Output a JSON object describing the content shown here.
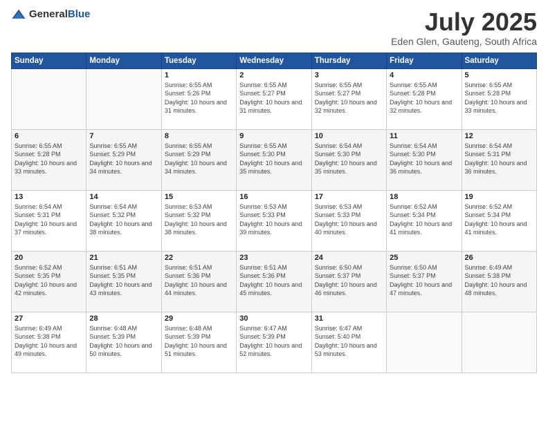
{
  "header": {
    "logo": {
      "general": "General",
      "blue": "Blue"
    },
    "title": "July 2025",
    "subtitle": "Eden Glen, Gauteng, South Africa"
  },
  "calendar": {
    "weekdays": [
      "Sunday",
      "Monday",
      "Tuesday",
      "Wednesday",
      "Thursday",
      "Friday",
      "Saturday"
    ],
    "weeks": [
      [
        {
          "day": "",
          "sunrise": "",
          "sunset": "",
          "daylight": ""
        },
        {
          "day": "",
          "sunrise": "",
          "sunset": "",
          "daylight": ""
        },
        {
          "day": "1",
          "sunrise": "Sunrise: 6:55 AM",
          "sunset": "Sunset: 5:26 PM",
          "daylight": "Daylight: 10 hours and 31 minutes."
        },
        {
          "day": "2",
          "sunrise": "Sunrise: 6:55 AM",
          "sunset": "Sunset: 5:27 PM",
          "daylight": "Daylight: 10 hours and 31 minutes."
        },
        {
          "day": "3",
          "sunrise": "Sunrise: 6:55 AM",
          "sunset": "Sunset: 5:27 PM",
          "daylight": "Daylight: 10 hours and 32 minutes."
        },
        {
          "day": "4",
          "sunrise": "Sunrise: 6:55 AM",
          "sunset": "Sunset: 5:28 PM",
          "daylight": "Daylight: 10 hours and 32 minutes."
        },
        {
          "day": "5",
          "sunrise": "Sunrise: 6:55 AM",
          "sunset": "Sunset: 5:28 PM",
          "daylight": "Daylight: 10 hours and 33 minutes."
        }
      ],
      [
        {
          "day": "6",
          "sunrise": "Sunrise: 6:55 AM",
          "sunset": "Sunset: 5:28 PM",
          "daylight": "Daylight: 10 hours and 33 minutes."
        },
        {
          "day": "7",
          "sunrise": "Sunrise: 6:55 AM",
          "sunset": "Sunset: 5:29 PM",
          "daylight": "Daylight: 10 hours and 34 minutes."
        },
        {
          "day": "8",
          "sunrise": "Sunrise: 6:55 AM",
          "sunset": "Sunset: 5:29 PM",
          "daylight": "Daylight: 10 hours and 34 minutes."
        },
        {
          "day": "9",
          "sunrise": "Sunrise: 6:55 AM",
          "sunset": "Sunset: 5:30 PM",
          "daylight": "Daylight: 10 hours and 35 minutes."
        },
        {
          "day": "10",
          "sunrise": "Sunrise: 6:54 AM",
          "sunset": "Sunset: 5:30 PM",
          "daylight": "Daylight: 10 hours and 35 minutes."
        },
        {
          "day": "11",
          "sunrise": "Sunrise: 6:54 AM",
          "sunset": "Sunset: 5:30 PM",
          "daylight": "Daylight: 10 hours and 36 minutes."
        },
        {
          "day": "12",
          "sunrise": "Sunrise: 6:54 AM",
          "sunset": "Sunset: 5:31 PM",
          "daylight": "Daylight: 10 hours and 36 minutes."
        }
      ],
      [
        {
          "day": "13",
          "sunrise": "Sunrise: 6:54 AM",
          "sunset": "Sunset: 5:31 PM",
          "daylight": "Daylight: 10 hours and 37 minutes."
        },
        {
          "day": "14",
          "sunrise": "Sunrise: 6:54 AM",
          "sunset": "Sunset: 5:32 PM",
          "daylight": "Daylight: 10 hours and 38 minutes."
        },
        {
          "day": "15",
          "sunrise": "Sunrise: 6:53 AM",
          "sunset": "Sunset: 5:32 PM",
          "daylight": "Daylight: 10 hours and 38 minutes."
        },
        {
          "day": "16",
          "sunrise": "Sunrise: 6:53 AM",
          "sunset": "Sunset: 5:33 PM",
          "daylight": "Daylight: 10 hours and 39 minutes."
        },
        {
          "day": "17",
          "sunrise": "Sunrise: 6:53 AM",
          "sunset": "Sunset: 5:33 PM",
          "daylight": "Daylight: 10 hours and 40 minutes."
        },
        {
          "day": "18",
          "sunrise": "Sunrise: 6:52 AM",
          "sunset": "Sunset: 5:34 PM",
          "daylight": "Daylight: 10 hours and 41 minutes."
        },
        {
          "day": "19",
          "sunrise": "Sunrise: 6:52 AM",
          "sunset": "Sunset: 5:34 PM",
          "daylight": "Daylight: 10 hours and 41 minutes."
        }
      ],
      [
        {
          "day": "20",
          "sunrise": "Sunrise: 6:52 AM",
          "sunset": "Sunset: 5:35 PM",
          "daylight": "Daylight: 10 hours and 42 minutes."
        },
        {
          "day": "21",
          "sunrise": "Sunrise: 6:51 AM",
          "sunset": "Sunset: 5:35 PM",
          "daylight": "Daylight: 10 hours and 43 minutes."
        },
        {
          "day": "22",
          "sunrise": "Sunrise: 6:51 AM",
          "sunset": "Sunset: 5:36 PM",
          "daylight": "Daylight: 10 hours and 44 minutes."
        },
        {
          "day": "23",
          "sunrise": "Sunrise: 6:51 AM",
          "sunset": "Sunset: 5:36 PM",
          "daylight": "Daylight: 10 hours and 45 minutes."
        },
        {
          "day": "24",
          "sunrise": "Sunrise: 6:50 AM",
          "sunset": "Sunset: 5:37 PM",
          "daylight": "Daylight: 10 hours and 46 minutes."
        },
        {
          "day": "25",
          "sunrise": "Sunrise: 6:50 AM",
          "sunset": "Sunset: 5:37 PM",
          "daylight": "Daylight: 10 hours and 47 minutes."
        },
        {
          "day": "26",
          "sunrise": "Sunrise: 6:49 AM",
          "sunset": "Sunset: 5:38 PM",
          "daylight": "Daylight: 10 hours and 48 minutes."
        }
      ],
      [
        {
          "day": "27",
          "sunrise": "Sunrise: 6:49 AM",
          "sunset": "Sunset: 5:38 PM",
          "daylight": "Daylight: 10 hours and 49 minutes."
        },
        {
          "day": "28",
          "sunrise": "Sunrise: 6:48 AM",
          "sunset": "Sunset: 5:39 PM",
          "daylight": "Daylight: 10 hours and 50 minutes."
        },
        {
          "day": "29",
          "sunrise": "Sunrise: 6:48 AM",
          "sunset": "Sunset: 5:39 PM",
          "daylight": "Daylight: 10 hours and 51 minutes."
        },
        {
          "day": "30",
          "sunrise": "Sunrise: 6:47 AM",
          "sunset": "Sunset: 5:39 PM",
          "daylight": "Daylight: 10 hours and 52 minutes."
        },
        {
          "day": "31",
          "sunrise": "Sunrise: 6:47 AM",
          "sunset": "Sunset: 5:40 PM",
          "daylight": "Daylight: 10 hours and 53 minutes."
        },
        {
          "day": "",
          "sunrise": "",
          "sunset": "",
          "daylight": ""
        },
        {
          "day": "",
          "sunrise": "",
          "sunset": "",
          "daylight": ""
        }
      ]
    ]
  }
}
